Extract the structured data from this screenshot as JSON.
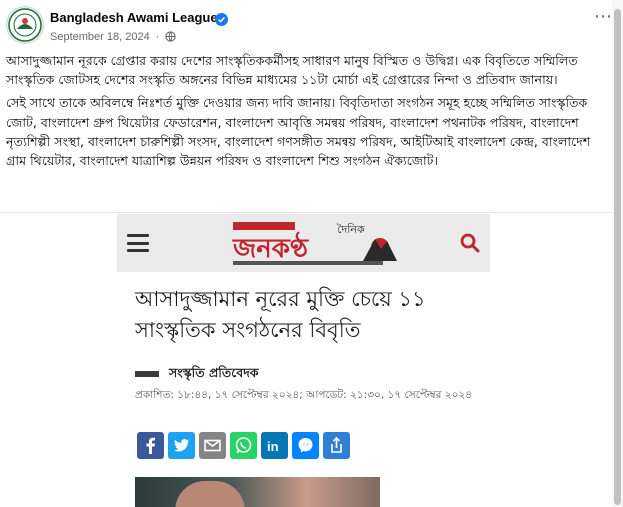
{
  "post": {
    "page_name": "Bangladesh Awami League",
    "date": "September 18, 2024",
    "separator": "·",
    "paragraphs": [
      "আসাদুজ্জামান নূরকে গ্রেপ্তার করায় দেশের সাংস্কৃতিককর্মীসহ সাধারণ মানুষ বিস্মিত ও উদ্বিগ্ন। এক বিবৃতিতে সম্মিলিত সাংস্কৃতিক জোটসহ দেশের সংস্কৃতি অঙ্গনের বিভিন্ন মাধ্যমের ১১টা মোর্চা এই গ্রেপ্তারের নিন্দা ও প্রতিবাদ জানায়।",
      "সেই সাথে তাকে অবিলম্বে নিঃশর্ত মুক্তি দেওয়ার জন্য দাবি জানায়। বিবৃতিদাতা সংগঠন সমূহ হচ্ছে সম্মিলিত সাংস্কৃতিক জোট, বাংলাদেশ গ্রুপ থিয়েটার ফেডারেশন, বাংলাদেশ আবৃত্তি সমন্বয় পরিষদ, বাংলাদেশ পথনাটক পরিষদ, বাংলাদেশ নৃত্যশিল্পী সংস্থা, বাংলাদেশ চারুশিল্পী সংসদ, বাংলাদেশ গণসঙ্গীত সমন্বয় পরিষদ, আইটিআই বাংলাদেশ কেন্দ্র, বাংলাদেশ গ্রাম থিয়েটার, বাংলাদেশ যাত্রাশিল্প উন্নয়ন পরিষদ ও বাংলাদেশ শিশু সংগঠন ঐক্যজোট।"
    ]
  },
  "article": {
    "logo_small_text": "দৈনিক",
    "logo_main_text": "জনকণ্ঠ",
    "headline": "আসাদুজ্জামান নূরের মুক্তি চেয়ে ১১ সাংস্কৃতিক সংগঠনের বিবৃতি",
    "author": "সংস্কৃতি প্রতিবেদক",
    "timestamp": "প্রকাশিত: ১৮:৪৪, ১৭ সেপ্টেম্বর ২০২৪; আপডেট: ২১:৩০, ১৭ সেপ্টেম্বর ২০২৪",
    "share_icons": [
      "facebook-icon",
      "twitter-icon",
      "email-icon",
      "whatsapp-icon",
      "linkedin-icon",
      "messenger-icon",
      "share-icon"
    ]
  },
  "colors": {
    "facebook": "#3b5998",
    "twitter": "#1da1f2",
    "email": "#848484",
    "whatsapp": "#25d366",
    "linkedin": "#0077b5",
    "messenger": "#0084ff",
    "share": "#2f7fd8",
    "verified": "#1877f2",
    "search_icon": "#c0262d"
  }
}
